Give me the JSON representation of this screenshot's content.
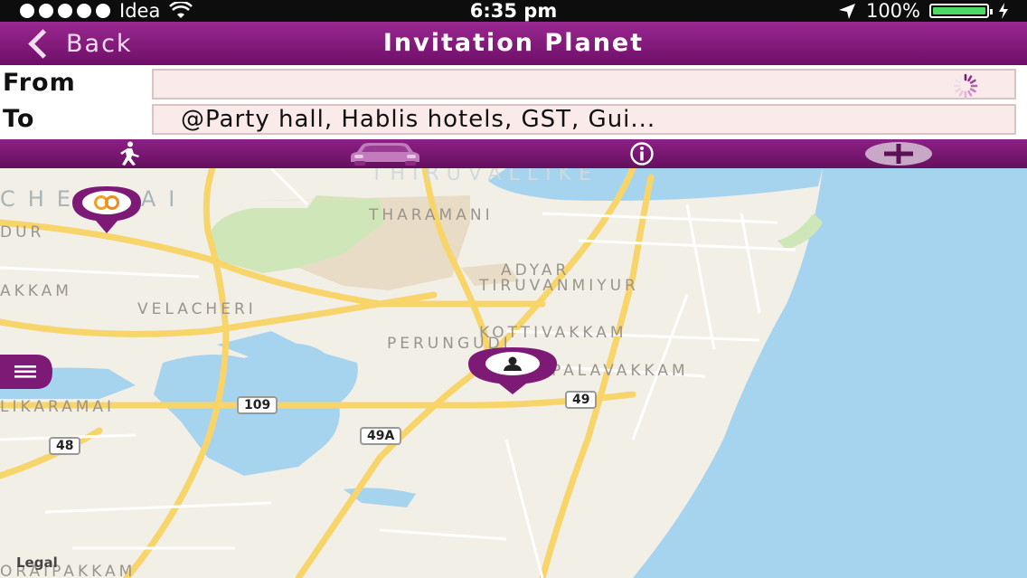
{
  "status_bar": {
    "carrier": "Idea",
    "time": "6:35 pm",
    "battery": "100%"
  },
  "nav": {
    "back_label": "Back",
    "title": "Invitation Planet"
  },
  "route": {
    "from_label": "From",
    "from_value": "",
    "to_label": "To",
    "to_value": "@Party hall, Hablis hotels, GST, Gui..."
  },
  "tabs": [
    "walk-icon",
    "car-icon",
    "info-icon",
    "plus-icon"
  ],
  "map": {
    "labels": {
      "chennai": "CHENNAI",
      "tharamani": "THARAMANI",
      "adyar": "ADYAR",
      "tiruvanmiyur": "TIRUVANMIYUR",
      "velacheri": "VELACHERI",
      "kottivakkam": "KOTTIVAKKAM",
      "perungudi": "PERUNGUDI",
      "palavakkam": "PALAVAKKAM",
      "akkam": "AKKAM",
      "dur": "DUR",
      "likaramai": "LIKARAMAI",
      "thiruvallikeni": "THIRUVALLIKE",
      "oraipakkam": "ORAIPAKKAM"
    },
    "shields": {
      "r109": "109",
      "r49": "49",
      "r49a": "49A",
      "r48": "48"
    },
    "legal": "Legal"
  },
  "colors": {
    "accent": "#7d1a76",
    "water": "#a6d4ee",
    "land": "#f2efe6",
    "park": "#cfe6b8",
    "road": "#f7d56b"
  }
}
